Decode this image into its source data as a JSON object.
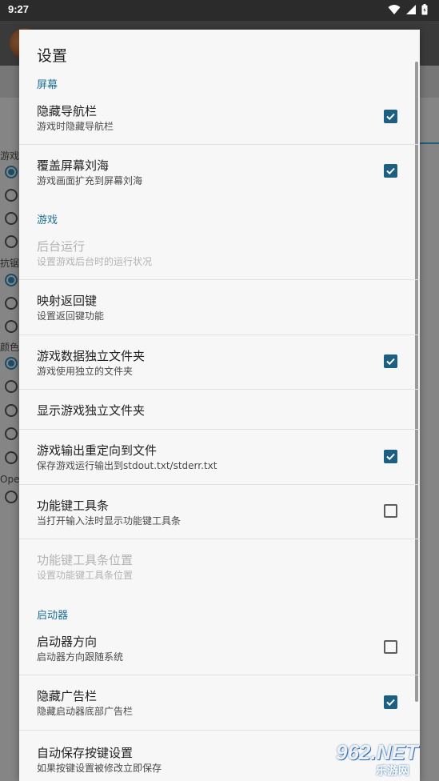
{
  "status_bar": {
    "time": "9:27"
  },
  "background": {
    "labels": [
      "游戏",
      "抗锯",
      "颜色",
      "Ope"
    ]
  },
  "dialog": {
    "title": "设置",
    "categories": {
      "screen": "屏幕",
      "game": "游戏",
      "launcher": "启动器"
    },
    "prefs": [
      {
        "title": "隐藏导航栏",
        "summary": "游戏时隐藏导航栏",
        "checked": true,
        "enabled": true
      },
      {
        "title": "覆盖屏幕刘海",
        "summary": "游戏画面扩充到屏幕刘海",
        "checked": true,
        "enabled": true
      },
      {
        "title": "后台运行",
        "summary": "设置游戏后台时的运行状况",
        "enabled": false
      },
      {
        "title": "映射返回键",
        "summary": "设置返回键功能",
        "enabled": true
      },
      {
        "title": "游戏数据独立文件夹",
        "summary": "游戏使用独立的文件夹",
        "checked": true,
        "enabled": true
      },
      {
        "title": "显示游戏独立文件夹",
        "enabled": true
      },
      {
        "title": "游戏输出重定向到文件",
        "summary": "保存游戏运行输出到stdout.txt/stderr.txt",
        "checked": true,
        "enabled": true
      },
      {
        "title": "功能键工具条",
        "summary": "当打开输入法时显示功能键工具条",
        "checked": false,
        "enabled": true
      },
      {
        "title": "功能键工具条位置",
        "summary": "设置功能键工具条位置",
        "enabled": false
      },
      {
        "title": "启动器方向",
        "summary": "启动器方向跟随系统",
        "checked": false,
        "enabled": true
      },
      {
        "title": "隐藏广告栏",
        "summary": "隐藏启动器底部广告栏",
        "checked": true,
        "enabled": true
      },
      {
        "title": "自动保存按键设置",
        "summary": "如果按键设置被修改立即保存",
        "enabled": true
      }
    ]
  },
  "watermark": {
    "brand": "962.NET",
    "sub": "乐游网"
  },
  "colors": {
    "accent": "#1c5f82",
    "category": "#1e6f96"
  }
}
